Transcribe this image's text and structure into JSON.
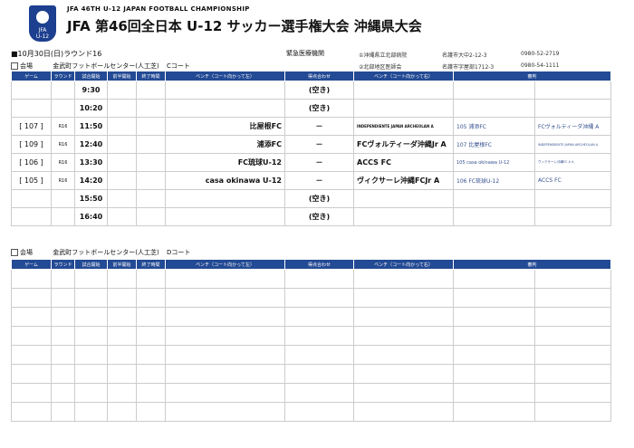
{
  "header": {
    "logo_text": "JFA\nU-12",
    "subtitle": "JFA 46TH U-12 JAPAN FOOTBALL CHAMPIONSHIP",
    "title": "JFA 第46回全日本 U-12 サッカー選手権大会 沖縄県大会"
  },
  "info": {
    "date_round": "■10月30日(日)ラウンド16",
    "emergency_label": "緊急医療機関",
    "hospitals": [
      {
        "name": "①沖縄県立北部病院",
        "address": "名護市大中2-12-3",
        "phone": "0980-52-2719"
      },
      {
        "name": "②北部地区医師会",
        "address": "名護市字屋部1712-3",
        "phone": "0980-54-1111"
      }
    ]
  },
  "venue_label": "会場",
  "courts": [
    {
      "venue": "金武町フットボールセンター(人工芝)",
      "court": "Cコート"
    },
    {
      "venue": "金武町フットボールセンター(人工芝)",
      "court": "Dコート"
    }
  ],
  "columns": {
    "game": "ゲーム",
    "round": "ラウンド",
    "kickoff": "試合開始",
    "first_half_end": "前半開始",
    "end": "終了時間",
    "bench_l": "ベンチ（コート向かって左）",
    "result": "得点合わせ",
    "bench_r": "ベンチ（コート向かって右）",
    "ref": "審判"
  },
  "schedule_c": [
    {
      "game": "",
      "round": "",
      "time": "9:30",
      "home": "",
      "mark": "(空き)",
      "away": "",
      "ref1": "",
      "ref2": ""
    },
    {
      "game": "",
      "round": "",
      "time": "10:20",
      "home": "",
      "mark": "(空き)",
      "away": "",
      "ref1": "",
      "ref2": ""
    },
    {
      "game": "[ 107 ]",
      "round": "R16",
      "time": "11:50",
      "home": "比屋根FC",
      "mark": "－",
      "away": "INDEPENDIENTE JAPAN ARCHEOLAN A",
      "ref1": "105 浦添FC",
      "ref2": "FCヴォルティーダ沖縄 A"
    },
    {
      "game": "[ 109 ]",
      "round": "R16",
      "time": "12:40",
      "home": "浦添FC",
      "mark": "－",
      "away": "FCヴォルティーダ沖縄Jr A",
      "ref1": "107 比屋根FC",
      "ref2": "INDEPENDIENTE JAPAN ARCHEOLAN A"
    },
    {
      "game": "[ 106 ]",
      "round": "R16",
      "time": "13:30",
      "home": "FC琉球U-12",
      "mark": "－",
      "away": "ACCS FC",
      "ref1": "105 casa okinawa U-12",
      "ref2": "ヴィクサーレ沖縄FC Jr A"
    },
    {
      "game": "[ 105 ]",
      "round": "R16",
      "time": "14:20",
      "home": "casa okinawa U-12",
      "mark": "－",
      "away": "ヴィクサーレ沖縄FCJr A",
      "ref1": "106 FC琉球U-12",
      "ref2": "ACCS FC"
    },
    {
      "game": "",
      "round": "",
      "time": "15:50",
      "home": "",
      "mark": "(空き)",
      "away": "",
      "ref1": "",
      "ref2": ""
    },
    {
      "game": "",
      "round": "",
      "time": "16:40",
      "home": "",
      "mark": "(空き)",
      "away": "",
      "ref1": "",
      "ref2": ""
    }
  ]
}
